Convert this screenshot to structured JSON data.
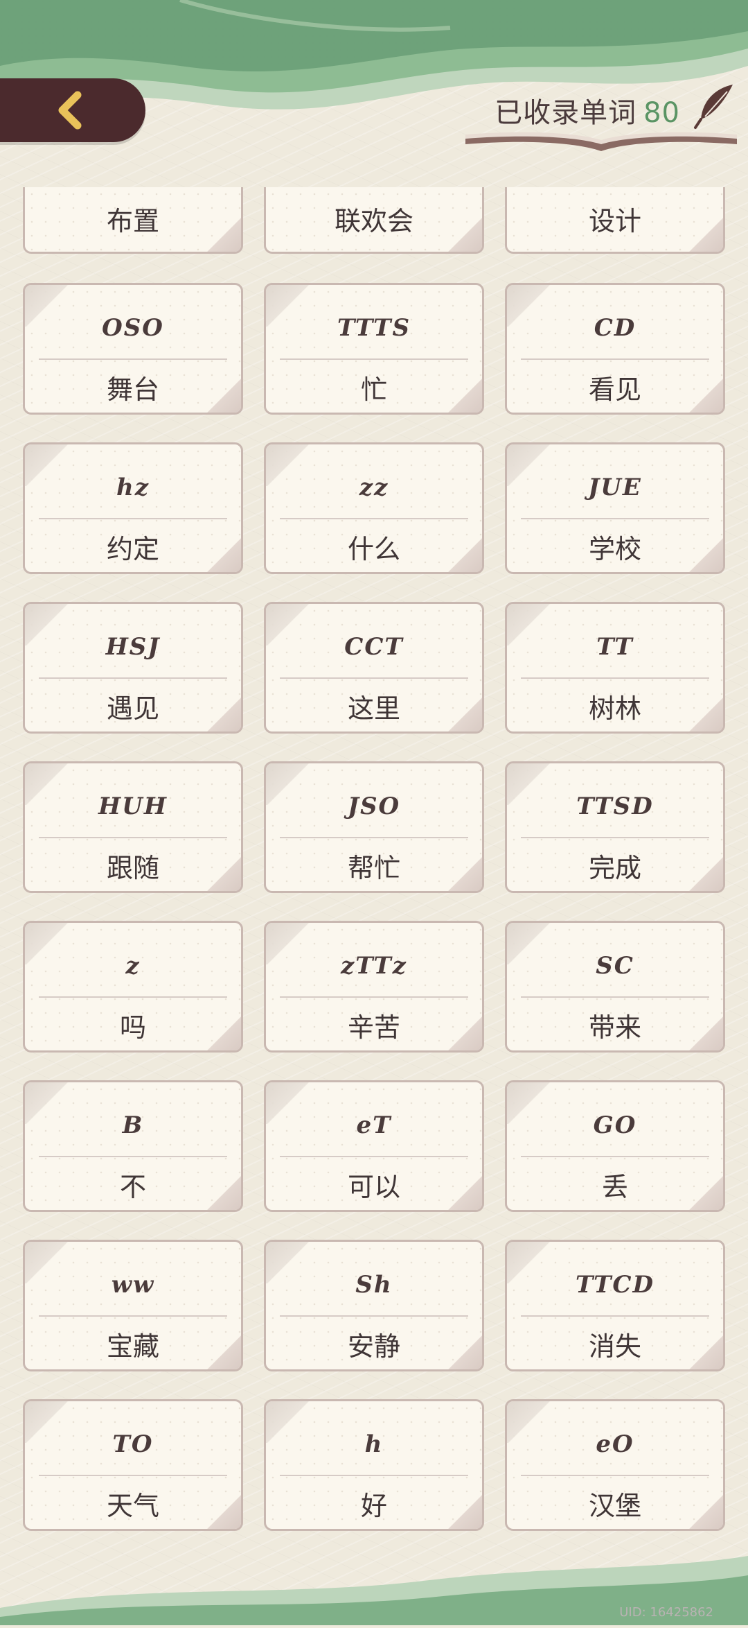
{
  "header": {
    "collected_label": "已收录单词",
    "collected_count": "80"
  },
  "top_row": [
    "布置",
    "联欢会",
    "设计"
  ],
  "cards": [
    {
      "sym": "OSO",
      "word": "舞台"
    },
    {
      "sym": "TTTS",
      "word": "忙"
    },
    {
      "sym": "CD",
      "word": "看见"
    },
    {
      "sym": "hz",
      "word": "约定"
    },
    {
      "sym": "zz",
      "word": "什么"
    },
    {
      "sym": "JUE",
      "word": "学校"
    },
    {
      "sym": "HSJ",
      "word": "遇见"
    },
    {
      "sym": "CCT",
      "word": "这里"
    },
    {
      "sym": "TT",
      "word": "树林"
    },
    {
      "sym": "HUH",
      "word": "跟随"
    },
    {
      "sym": "JSO",
      "word": "帮忙"
    },
    {
      "sym": "TTSD",
      "word": "完成"
    },
    {
      "sym": "z",
      "word": "吗"
    },
    {
      "sym": "zTTz",
      "word": "辛苦"
    },
    {
      "sym": "SC",
      "word": "带来"
    },
    {
      "sym": "B",
      "word": "不"
    },
    {
      "sym": "eT",
      "word": "可以"
    },
    {
      "sym": "GO",
      "word": "丢"
    },
    {
      "sym": "ww",
      "word": "宝藏"
    },
    {
      "sym": "Sh",
      "word": "安静"
    },
    {
      "sym": "TTCD",
      "word": "消失"
    },
    {
      "sym": "TO",
      "word": "天气"
    },
    {
      "sym": "h",
      "word": "好"
    },
    {
      "sym": "eO",
      "word": "汉堡"
    }
  ],
  "footer": {
    "uid": "UID: 16425862"
  },
  "colors": {
    "accent_green": "#5a9464",
    "back_button": "#4b2a2d",
    "card_bg": "#fbf7ee",
    "card_border": "#c9b8b1"
  }
}
